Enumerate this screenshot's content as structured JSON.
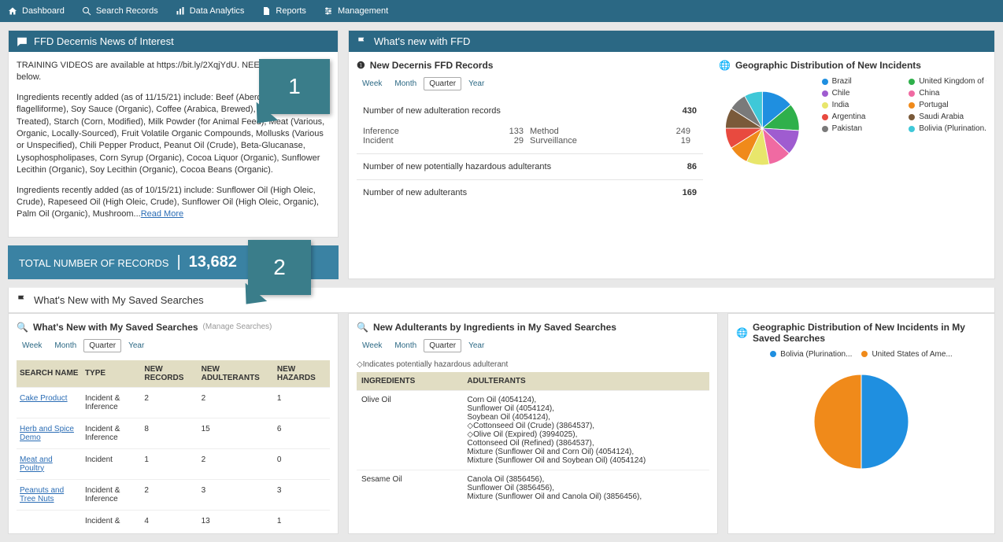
{
  "nav": [
    {
      "label": "Dashboard",
      "icon": "home"
    },
    {
      "label": "Search Records",
      "icon": "search"
    },
    {
      "label": "Data Analytics",
      "icon": "chart"
    },
    {
      "label": "Reports",
      "icon": "doc"
    },
    {
      "label": "Management",
      "icon": "settings"
    }
  ],
  "news": {
    "title": "FFD Decernis News of Interest",
    "p1": "TRAINING VIDEOS are available at https://bit.ly/2XqjYdU. NEED ASSISTANCE below.",
    "p2": "Ingredients recently added (as of 11/15/21) include: Beef (Aberdeen Angus), ... flagelliforme), Soy Sauce (Organic), Coffee (Arabica, Brewed), Flour (Heat Treated), Starch (Corn, Modified), Milk Powder (for Animal Feed), Meat (Various, Organic, Locally-Sourced), Fruit Volatile Organic Compounds, Mollusks (Various or Unspecified), Chili Pepper Product, Peanut Oil (Crude), Beta-Glucanase, Lysophospholipases, Corn Syrup (Organic), Cocoa Liquor (Organic), Sunflower Lecithin (Organic), Soy Lecithin (Organic), Cocoa Beans (Organic).",
    "p3a": "Ingredients recently added (as of 10/15/21) include: Sunflower Oil (High Oleic, Crude), Rapeseed Oil (High Oleic, Crude), Sunflower Oil (High Oleic, Organic), Palm Oil (Organic), Mushroom...",
    "read_more": "Read More"
  },
  "totals": {
    "label": "TOTAL NUMBER OF RECORDS",
    "value": "13,682"
  },
  "whats_new_ffd_title": "What's new with FFD",
  "new_records_title": "New Decernis FFD Records",
  "geo_title": "Geographic Distribution of New Incidents",
  "ranges": [
    "Week",
    "Month",
    "Quarter",
    "Year"
  ],
  "active_range": "Quarter",
  "stats": {
    "adulteration": {
      "label": "Number of new adulteration records",
      "value": "430"
    },
    "sub": {
      "inference_l": "Inference",
      "inference_v": "133",
      "method_l": "Method",
      "method_v": "249",
      "incident_l": "Incident",
      "incident_v": "29",
      "surveillance_l": "Surveillance",
      "surveillance_v": "19"
    },
    "hazardous": {
      "label": "Number of new potentially hazardous adulterants",
      "value": "86"
    },
    "adulterants": {
      "label": "Number of new adulterants",
      "value": "169"
    }
  },
  "chart_data": {
    "type": "pie",
    "title": "Geographic Distribution of New Incidents",
    "series": [
      {
        "name": "Brazil",
        "color": "#1f8fe0",
        "value": 14
      },
      {
        "name": "United Kingdom of Gr...",
        "color": "#2fb04b",
        "value": 12
      },
      {
        "name": "Chile",
        "color": "#9f5cd0",
        "value": 11
      },
      {
        "name": "China",
        "color": "#f06aa2",
        "value": 10
      },
      {
        "name": "India",
        "color": "#e8e66b",
        "value": 10
      },
      {
        "name": "Portugal",
        "color": "#f08a1a",
        "value": 9
      },
      {
        "name": "Argentina",
        "color": "#e84a3f",
        "value": 9
      },
      {
        "name": "Saudi Arabia",
        "color": "#7a5a3a",
        "value": 9
      },
      {
        "name": "Pakistan",
        "color": "#7a7a7a",
        "value": 8
      },
      {
        "name": "Bolivia (Plurination...",
        "color": "#3fc8d8",
        "value": 8
      }
    ]
  },
  "saved_section_title": "What's New with My Saved Searches",
  "saved_sub": "What's New with My Saved Searches",
  "manage": "(Manage Searches)",
  "saved_cols": {
    "c1": "SEARCH NAME",
    "c2": "TYPE",
    "c3": "NEW RECORDS",
    "c4": "NEW ADULTERANTS",
    "c5": "NEW HAZARDS"
  },
  "saved_rows": [
    {
      "name": "Cake Product",
      "type": "Incident & Inference",
      "r": "2",
      "a": "2",
      "h": "1"
    },
    {
      "name": "Herb and Spice Demo",
      "type": "Incident & Inference",
      "r": "8",
      "a": "15",
      "h": "6"
    },
    {
      "name": "Meat and Poultry",
      "type": "Incident",
      "r": "1",
      "a": "2",
      "h": "0"
    },
    {
      "name": "Peanuts and Tree Nuts",
      "type": "Incident & Inference",
      "r": "2",
      "a": "3",
      "h": "3"
    },
    {
      "name": "",
      "type": "Incident & Inference",
      "r": "4",
      "a": "13",
      "h": "1"
    }
  ],
  "new_adult_title": "New Adulterants by Ingredients in My Saved Searches",
  "hazard_note": "◇Indicates potentially hazardous adulterant",
  "ing_cols": {
    "c1": "INGREDIENTS",
    "c2": "ADULTERANTS"
  },
  "ing_rows": [
    {
      "ing": "Olive Oil",
      "adult": "Corn Oil (4054124),\nSunflower Oil (4054124),\nSoybean Oil (4054124),\n◇Cottonseed Oil (Crude) (3864537),\n◇Olive Oil (Expired) (3994025),\nCottonseed Oil (Refined) (3864537),\nMixture (Sunflower Oil and Corn Oil) (4054124),\nMixture (Sunflower Oil and Soybean Oil) (4054124)"
    },
    {
      "ing": "Sesame Oil",
      "adult": "Canola Oil (3856456),\nSunflower Oil (3856456),\nMixture (Sunflower Oil and Canola Oil) (3856456),"
    }
  ],
  "geo_saved_title": "Geographic Distribution of New Incidents in My Saved Searches",
  "chart_data2": {
    "type": "pie",
    "series": [
      {
        "name": "Bolivia (Plurination...",
        "color": "#1f8fe0",
        "value": 50
      },
      {
        "name": "United States of Ame...",
        "color": "#f08a1a",
        "value": 50
      }
    ]
  },
  "callouts": {
    "c1": "1",
    "c2": "2"
  }
}
